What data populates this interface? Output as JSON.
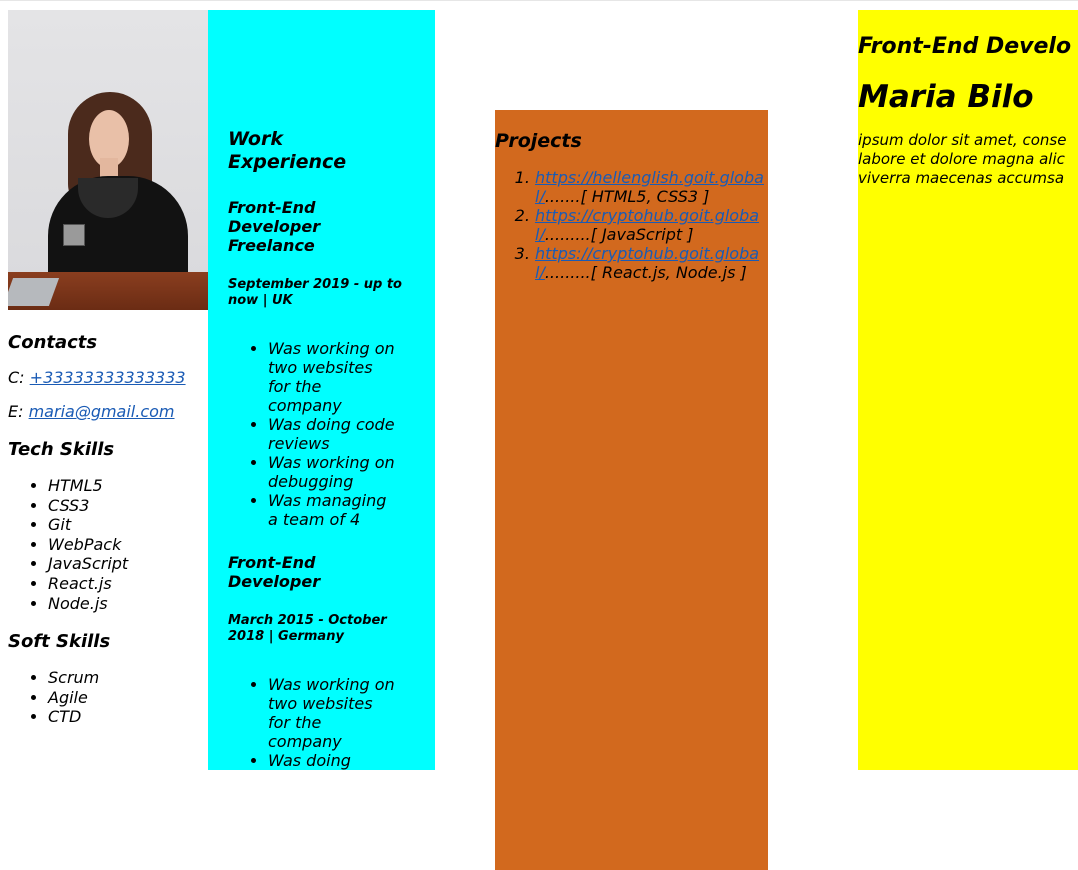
{
  "contacts": {
    "heading": "Contacts",
    "phone_prefix": "C:",
    "phone": "+33333333333333",
    "email_prefix": "E:",
    "email": "maria@gmail.com"
  },
  "tech_skills": {
    "heading": "Tech Skills",
    "items": [
      "HTML5",
      "CSS3",
      "Git",
      "WebPack",
      "JavaScript",
      "React.js",
      "Node.js"
    ]
  },
  "soft_skills": {
    "heading": "Soft Skills",
    "items": [
      "Scrum",
      "Agile",
      "CTD"
    ]
  },
  "work": {
    "heading": "Work Experience",
    "jobs": [
      {
        "title": "Front-End Developer Freelance",
        "period": "September 2019 - up to now | UK",
        "duties": [
          "Was working on two websites for the company",
          "Was doing code reviews",
          "Was working on debugging",
          "Was managing a team of 4"
        ]
      },
      {
        "title": "Front-End Developer",
        "period": "March 2015 - October 2018 | Germany",
        "duties": [
          "Was working on two websites for the company",
          "Was doing"
        ]
      }
    ]
  },
  "projects": {
    "heading": "Projects",
    "items": [
      {
        "url": "https://hellenglish.goit.global/",
        "note": ".......[ HTML5, CSS3 ]"
      },
      {
        "url": "https://cryptohub.goit.global/",
        "note": ".........[ JavaScript ]"
      },
      {
        "url": "https://cryptohub.goit.global/",
        "note": ".........[ React.js, Node.js ]"
      }
    ]
  },
  "intro": {
    "role": "Front-End Develo",
    "name": "Maria Bilo",
    "lorem_lines": [
      "ipsum dolor sit amet, conse",
      "labore et dolore magna alic",
      "viverra maecenas accumsa"
    ]
  },
  "colors": {
    "work_bg": "#00ffff",
    "projects_bg": "#d2691e",
    "intro_bg": "#ffff00",
    "link": "#1a5bb5"
  }
}
